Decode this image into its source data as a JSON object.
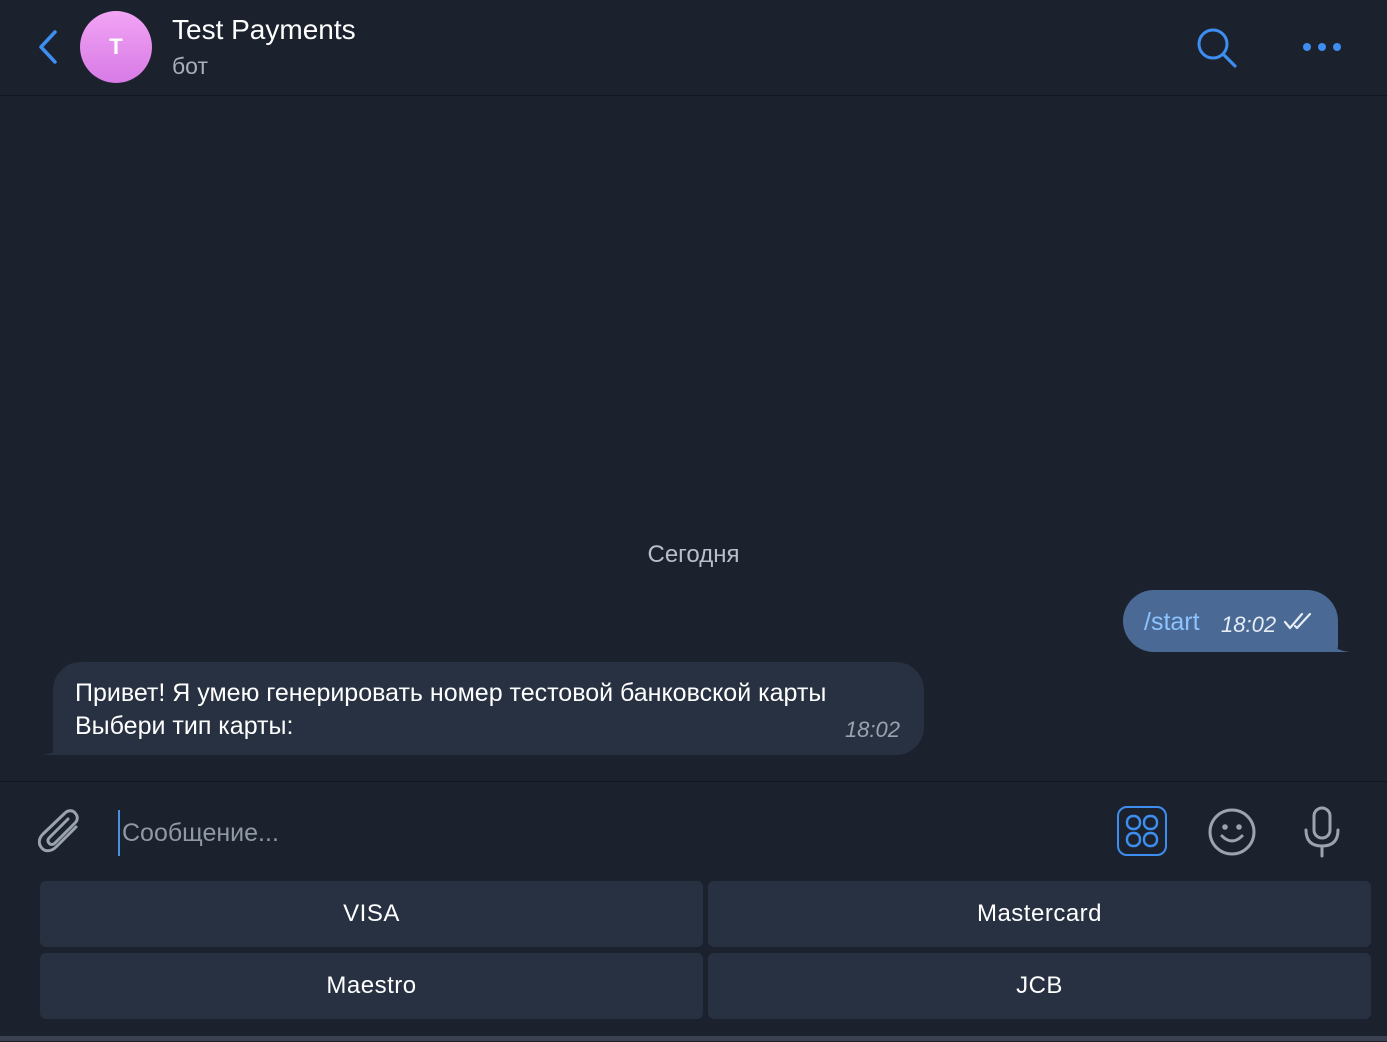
{
  "header": {
    "title": "Test Payments",
    "subtitle": "бот",
    "avatar_letter": "T"
  },
  "chat": {
    "date_separator": "Сегодня",
    "messages": [
      {
        "direction": "outgoing",
        "text": "/start",
        "time": "18:02",
        "status": "read"
      },
      {
        "direction": "incoming",
        "lines": [
          "Привет! Я умею генерировать номер тестовой банковской карты",
          "Выбери тип карты:"
        ],
        "time": "18:02"
      }
    ]
  },
  "composer": {
    "placeholder": "Сообщение..."
  },
  "keyboard": {
    "buttons": [
      "VISA",
      "Mastercard",
      "Maestro",
      "JCB"
    ]
  },
  "colors": {
    "background": "#1b222e",
    "accent": "#3d8ef0",
    "outgoing_bubble": "#4a6a95",
    "incoming_bubble": "#273142",
    "avatar": "#e08ff0"
  },
  "icons": [
    "chevron-left-icon",
    "search-icon",
    "more-icon",
    "paperclip-icon",
    "keyboard-grid-icon",
    "emoji-icon",
    "microphone-icon",
    "double-check-icon"
  ]
}
